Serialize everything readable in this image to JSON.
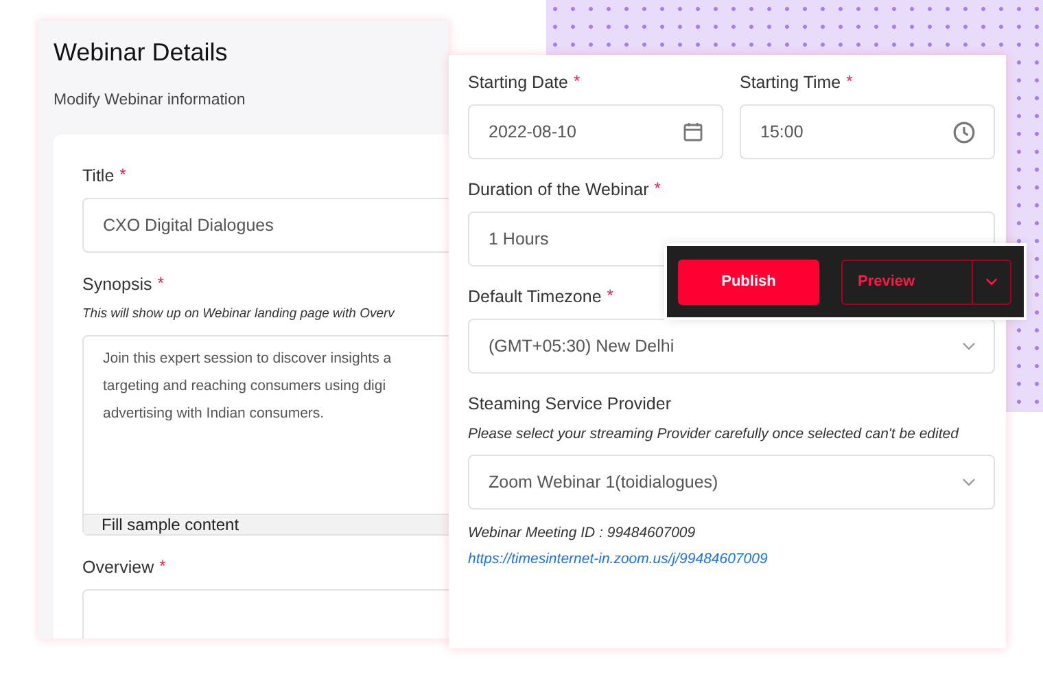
{
  "details_card": {
    "title": "Webinar Details",
    "subtitle": "Modify Webinar information",
    "fields": [
      {
        "kind": "input",
        "label": "Title",
        "required_mark": "*",
        "value": "CXO Digital Dialogues"
      },
      {
        "kind": "textarea",
        "label": "Synopsis",
        "required_mark": "*",
        "hint": "This will show up on Webinar landing page with Overv",
        "value": "Join this expert session to discover insights a\ntargeting and reaching consumers using digi\nadvertising with Indian consumers.",
        "footer_button": "Fill sample content"
      },
      {
        "kind": "input",
        "label": "Overview",
        "required_mark": "*"
      }
    ]
  },
  "schedule_card": {
    "rows": [
      [
        {
          "kind": "date",
          "label": "Starting Date",
          "required_mark": "*",
          "value": "2022-08-10"
        },
        {
          "kind": "time",
          "label": "Starting Time",
          "required_mark": "*",
          "value": "15:00"
        }
      ],
      [
        {
          "kind": "input",
          "label": "Duration of the Webinar",
          "required_mark": "*",
          "value": "1 Hours"
        }
      ],
      [
        {
          "kind": "select",
          "label": "Default Timezone",
          "required_mark": "*",
          "value": "(GMT+05:30) New Delhi"
        }
      ],
      [
        {
          "kind": "select",
          "label": "Steaming Service Provider",
          "hint": "Please select your streaming Provider carefully once selected can't be edited",
          "value": "Zoom Webinar 1(toidialogues)"
        }
      ]
    ],
    "meeting_id": "Webinar Meeting ID : 99484607009",
    "meeting_link": "https://timesinternet-in.zoom.us/j/99484607009"
  },
  "action_bar": {
    "publish": "Publish",
    "preview": "Preview"
  }
}
